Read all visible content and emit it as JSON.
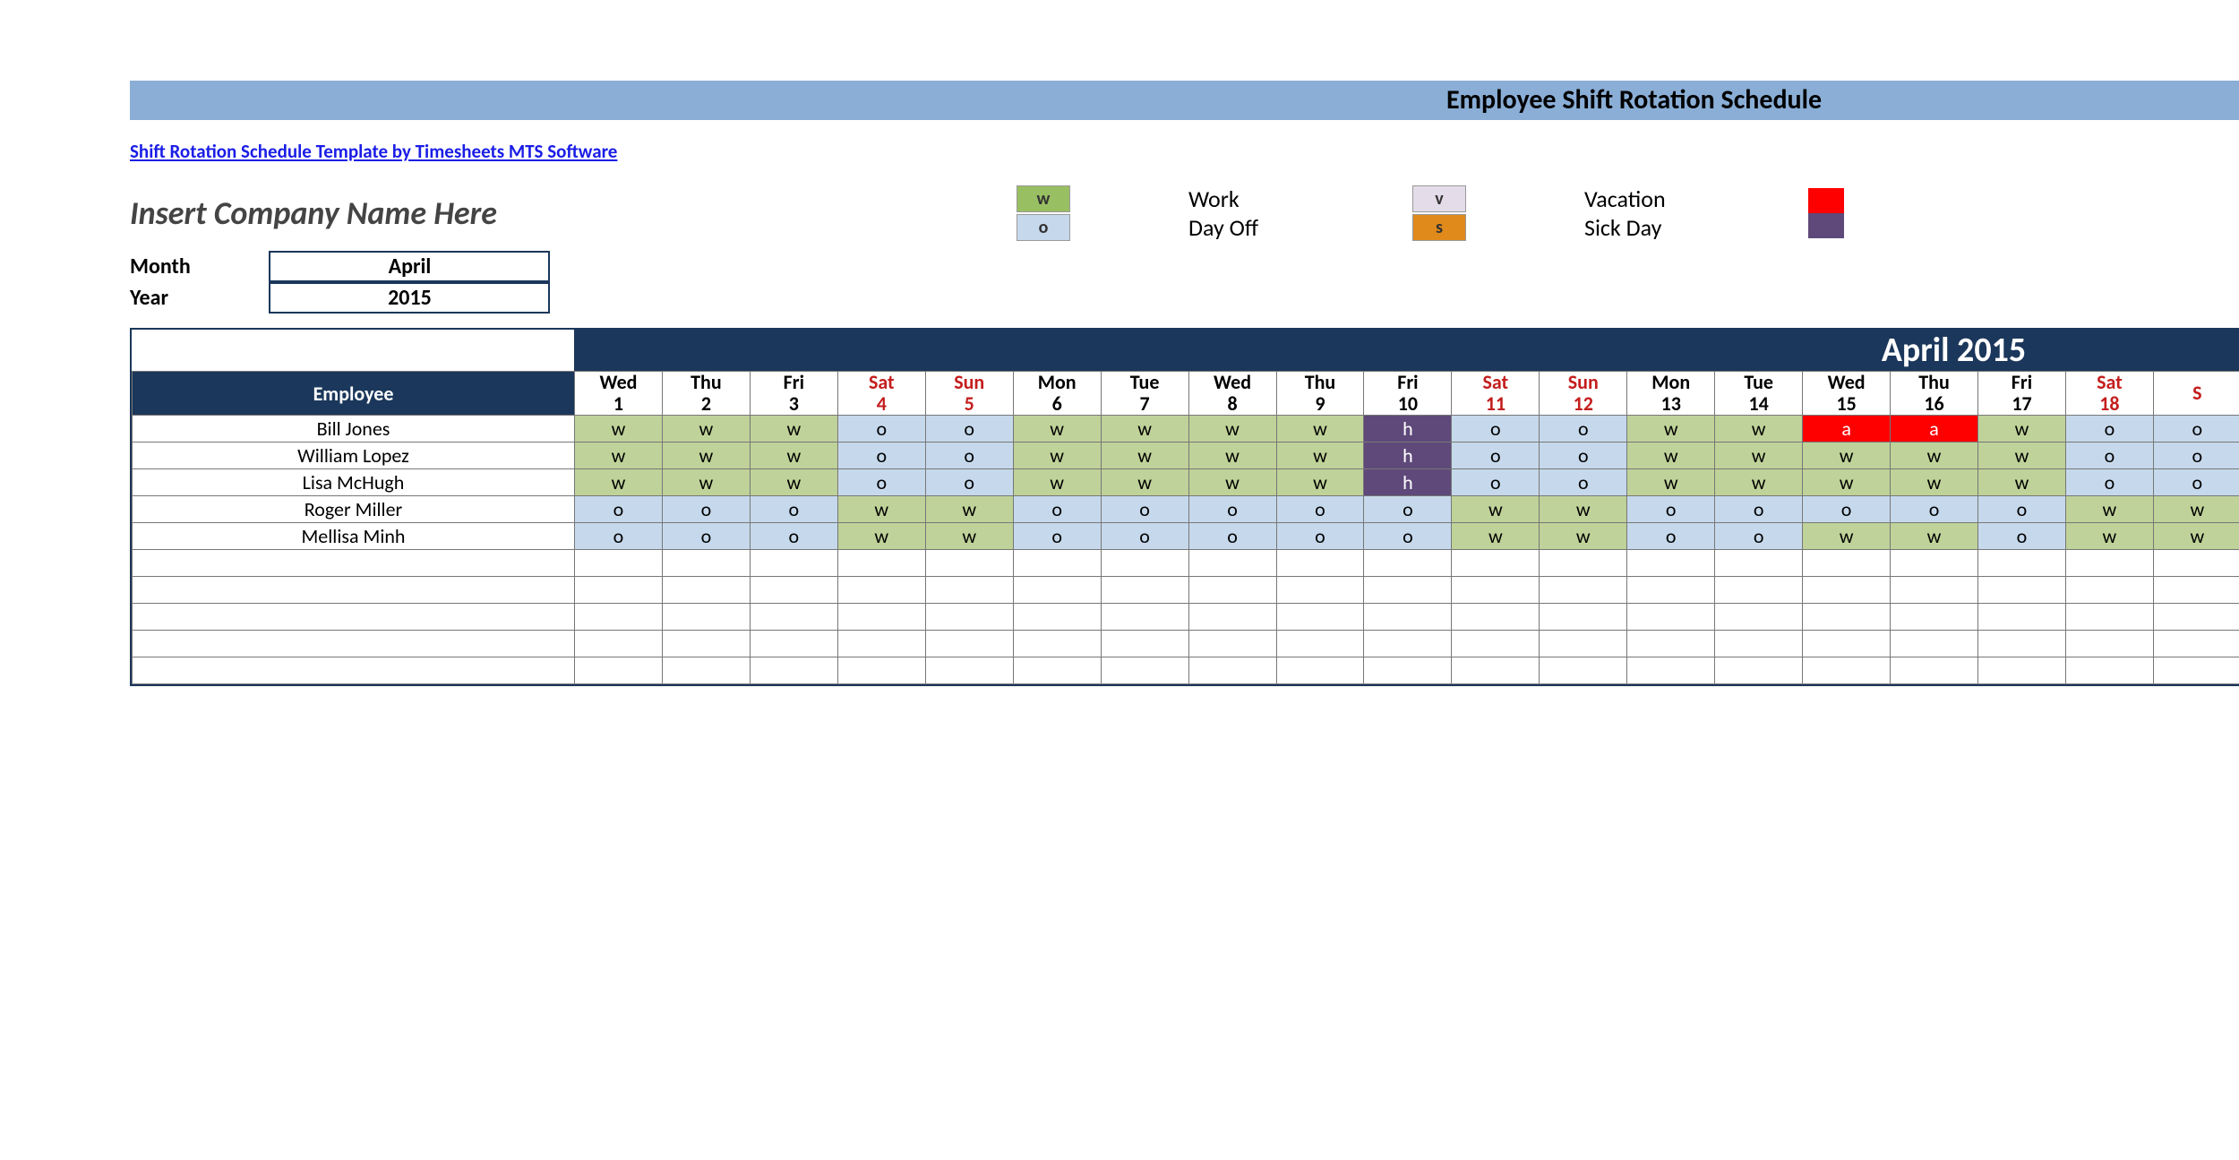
{
  "title": "Employee Shift Rotation Schedule",
  "source_link": "Shift Rotation Schedule Template by Timesheets MTS Software",
  "company": "Insert Company Name Here",
  "month_label": "Month",
  "month_value": "April",
  "year_label": "Year",
  "year_value": "2015",
  "month_banner": "April 2015",
  "employee_header": "Employee",
  "legend": [
    {
      "code": "w",
      "label": "Work",
      "swatch": "swatch-w"
    },
    {
      "code": "o",
      "label": "Day Off",
      "swatch": "swatch-o"
    },
    {
      "code": "v",
      "label": "Vacation",
      "swatch": "swatch-v"
    },
    {
      "code": "s",
      "label": "Sick Day",
      "swatch": "swatch-s"
    }
  ],
  "extra_swatches": [
    "swatch-red",
    "swatch-purple"
  ],
  "days": [
    {
      "dow": "Wed",
      "num": "1",
      "weekend": false
    },
    {
      "dow": "Thu",
      "num": "2",
      "weekend": false
    },
    {
      "dow": "Fri",
      "num": "3",
      "weekend": false
    },
    {
      "dow": "Sat",
      "num": "4",
      "weekend": true
    },
    {
      "dow": "Sun",
      "num": "5",
      "weekend": true
    },
    {
      "dow": "Mon",
      "num": "6",
      "weekend": false
    },
    {
      "dow": "Tue",
      "num": "7",
      "weekend": false
    },
    {
      "dow": "Wed",
      "num": "8",
      "weekend": false
    },
    {
      "dow": "Thu",
      "num": "9",
      "weekend": false
    },
    {
      "dow": "Fri",
      "num": "10",
      "weekend": false
    },
    {
      "dow": "Sat",
      "num": "11",
      "weekend": true
    },
    {
      "dow": "Sun",
      "num": "12",
      "weekend": true
    },
    {
      "dow": "Mon",
      "num": "13",
      "weekend": false
    },
    {
      "dow": "Tue",
      "num": "14",
      "weekend": false
    },
    {
      "dow": "Wed",
      "num": "15",
      "weekend": false
    },
    {
      "dow": "Thu",
      "num": "16",
      "weekend": false
    },
    {
      "dow": "Fri",
      "num": "17",
      "weekend": false
    },
    {
      "dow": "Sat",
      "num": "18",
      "weekend": true
    },
    {
      "dow": "S",
      "num": "",
      "weekend": true
    }
  ],
  "employees": [
    {
      "name": "Bill Jones",
      "codes": [
        "w",
        "w",
        "w",
        "o",
        "o",
        "w",
        "w",
        "w",
        "w",
        "h",
        "o",
        "o",
        "w",
        "w",
        "a",
        "a",
        "w",
        "o",
        "o"
      ]
    },
    {
      "name": "William Lopez",
      "codes": [
        "w",
        "w",
        "w",
        "o",
        "o",
        "w",
        "w",
        "w",
        "w",
        "h",
        "o",
        "o",
        "w",
        "w",
        "w",
        "w",
        "w",
        "o",
        "o"
      ]
    },
    {
      "name": "Lisa McHugh",
      "codes": [
        "w",
        "w",
        "w",
        "o",
        "o",
        "w",
        "w",
        "w",
        "w",
        "h",
        "o",
        "o",
        "w",
        "w",
        "w",
        "w",
        "w",
        "o",
        "o"
      ]
    },
    {
      "name": "Roger Miller",
      "codes": [
        "o",
        "o",
        "o",
        "w",
        "w",
        "o",
        "o",
        "o",
        "o",
        "o",
        "w",
        "w",
        "o",
        "o",
        "o",
        "o",
        "o",
        "w",
        "w"
      ]
    },
    {
      "name": "Mellisa Minh",
      "codes": [
        "o",
        "o",
        "o",
        "w",
        "w",
        "o",
        "o",
        "o",
        "o",
        "o",
        "w",
        "w",
        "o",
        "o",
        "w",
        "w",
        "o",
        "w",
        "w"
      ]
    }
  ],
  "empty_rows": 5
}
